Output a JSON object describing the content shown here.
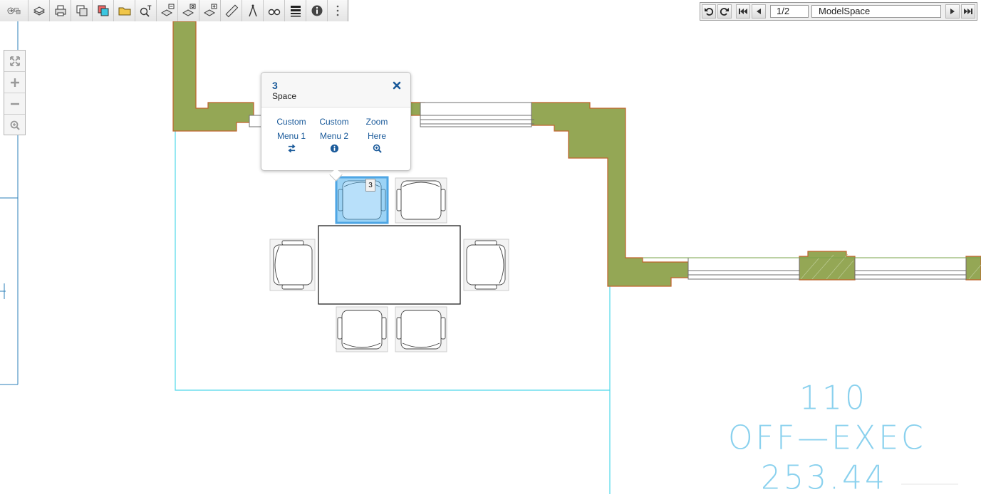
{
  "toolbar": {
    "tools": [
      {
        "name": "back-icon",
        "title": "navigate"
      },
      {
        "name": "layers-icon"
      },
      {
        "name": "print-icon"
      },
      {
        "name": "copy-window-icon"
      },
      {
        "name": "color-window-icon"
      },
      {
        "name": "open-folder-icon"
      },
      {
        "name": "find-text-icon"
      },
      {
        "name": "layer-remove-icon"
      },
      {
        "name": "layer-swap-icon"
      },
      {
        "name": "layer-add-icon"
      },
      {
        "name": "measure-icon"
      },
      {
        "name": "compass-icon"
      },
      {
        "name": "binoculars-icon"
      },
      {
        "name": "lineweight-icon"
      },
      {
        "name": "info-icon"
      },
      {
        "name": "more-icon"
      }
    ]
  },
  "navigation": {
    "page": "1/2",
    "space": "ModelSpace"
  },
  "zoom_panel": {
    "buttons": [
      "zoom-extents-icon",
      "zoom-in-icon",
      "zoom-out-icon",
      "zoom-window-icon"
    ]
  },
  "popup": {
    "number": "3",
    "subtitle": "Space",
    "menu": [
      {
        "line1": "Custom",
        "line2": "Menu 1",
        "icon": "swap-icon"
      },
      {
        "line1": "Custom",
        "line2": "Menu 2",
        "icon": "info-circle-icon"
      },
      {
        "line1": "Zoom",
        "line2": "Here",
        "icon": "zoom-plus-icon"
      }
    ]
  },
  "chair_tooltip": "3",
  "room": {
    "number": "110",
    "name": "OFF—EXEC",
    "area": "253.44"
  },
  "colors": {
    "wall_fill": "#94a755",
    "wall_outline": "#c0622b",
    "room_boundary": "#4fd8ea",
    "selection": "#9cd3f5",
    "link": "#1a5a9a",
    "room_text": "#8ad1ee"
  }
}
